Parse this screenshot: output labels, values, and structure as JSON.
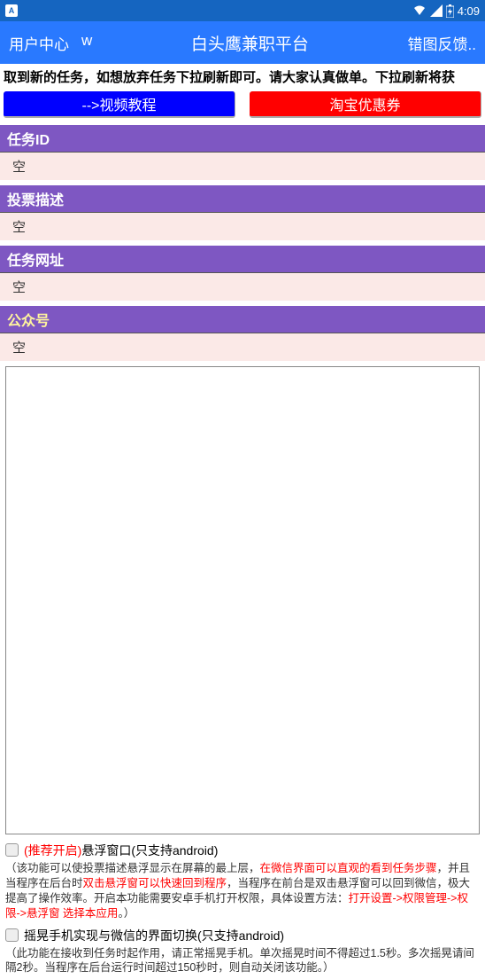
{
  "statusBar": {
    "appIndicator": "A",
    "time": "4:09"
  },
  "appBar": {
    "userCenter": "用户中心",
    "w": "w",
    "title": "白头鹰兼职平台",
    "feedback": "错图反馈.."
  },
  "notice": "取到新的任务，如想放弃任务下拉刷新即可。请大家认真做单。下拉刷新将获",
  "buttons": {
    "video": "-->视频教程",
    "taobao": "淘宝优惠券"
  },
  "sections": {
    "taskId": {
      "label": "任务ID",
      "value": "空"
    },
    "voteDesc": {
      "label": "投票描述",
      "value": "空"
    },
    "taskUrl": {
      "label": "任务网址",
      "value": "空"
    },
    "gzh": {
      "label": "公众号",
      "value": "空"
    }
  },
  "checkbox1": {
    "recommend": "(推荐开启)",
    "label": "悬浮窗口(只支持android)",
    "desc1": "（该功能可以使投票描述悬浮显示在屏幕的最上层，",
    "desc1red": "在微信界面可以直观的看到任务步骤",
    "desc1b": "，并且当程序在后台时",
    "desc1red2": "双击悬浮窗可以快速回到程序",
    "desc1c": "，当程序在前台是双击悬浮窗可以回到微信，极大提高了操作效率。开启本功能需要安卓手机打开权限，具体设置方法：",
    "desc1red3": "打开设置->权限管理->权限->悬浮窗 选择本应用",
    "desc1d": "。）"
  },
  "checkbox2": {
    "label": "摇晃手机实现与微信的界面切换(只支持android)",
    "desc": "（此功能在接收到任务时起作用，请正常摇晃手机。单次摇晃时间不得超过1.5秒。多次摇晃请间隔2秒。当程序在后台运行时间超过150秒时，则自动关闭该功能。）"
  }
}
